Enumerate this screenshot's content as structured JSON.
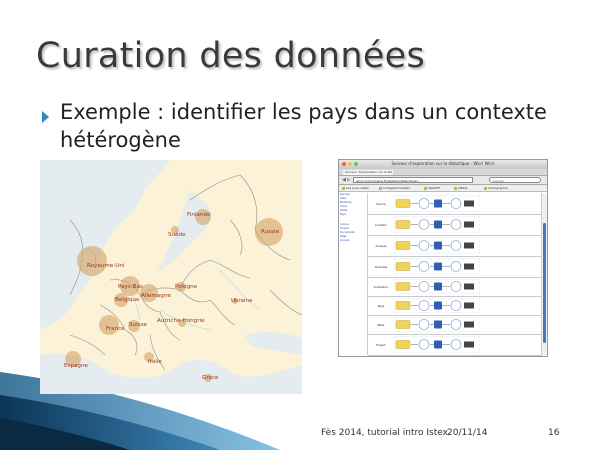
{
  "slide": {
    "title": "Curation des données",
    "bullet": "Exemple : identifier les pays dans un contexte hétérogène",
    "footer": {
      "event": "Fès 2014, tutorial intro Istex",
      "date": "20/11/14",
      "page": "16"
    }
  },
  "map": {
    "labels": [
      "Finlande",
      "Suède",
      "Russie",
      "Royaume-Uni",
      "Pays-Bas",
      "Belgique",
      "Allemagne",
      "Pologne",
      "France",
      "Suisse",
      "Autriche-Hongrie",
      "Ukraine",
      "Espagne",
      "Italie",
      "Grèce"
    ],
    "colors": {
      "land": "#fbf2d7",
      "sea": "#e4ecef",
      "border": "#8f8f8f",
      "bubble": "#d5a86e"
    }
  },
  "browser": {
    "window_title": "Serveur d'exploration sur la didactique - Wicri Wicri",
    "tab": "Serveur d'exploration sur la did",
    "url": "wicri.univ-lorraine.fr/sandbox/didactique/...",
    "search_placeholder": "Google",
    "bookmarks": [
      "Les plus visités",
      "Collège/Inria/Istex",
      "WebDiff",
      "UBRAL",
      "Cartographie"
    ],
    "sidebar_links": [
      "Serveur",
      "Liste",
      "Méthode",
      "Index",
      "Outils",
      "Pays",
      "Corpus",
      "Travail",
      "Documents",
      "Page",
      "Accueil"
    ],
    "rows": [
      "Source",
      "Curation",
      "Analyse",
      "Données",
      "Indexation",
      "Pays",
      "Base",
      "Export"
    ],
    "accent": "#4a72c8"
  }
}
